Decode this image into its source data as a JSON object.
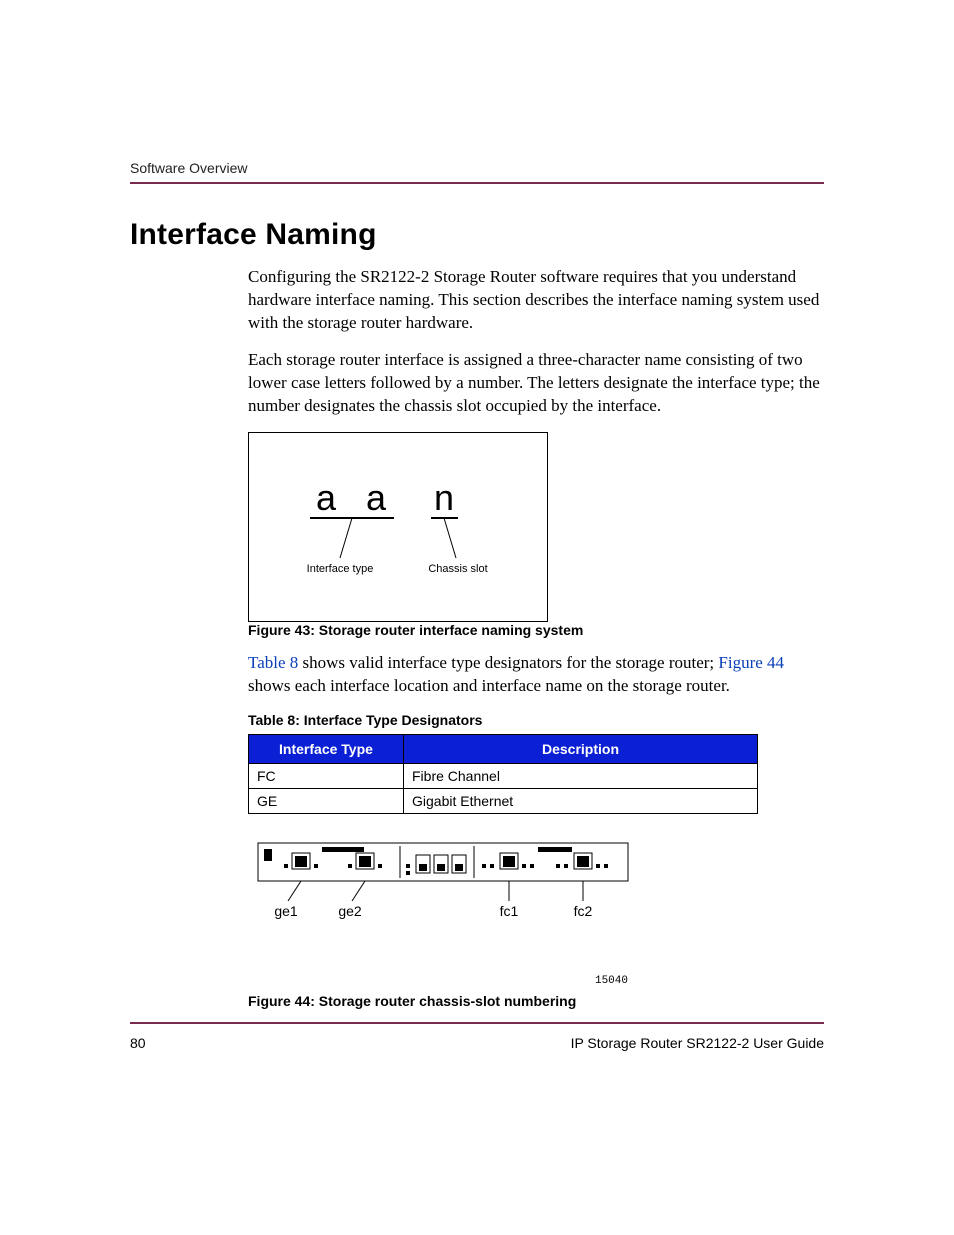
{
  "header": {
    "running": "Software Overview"
  },
  "title": "Interface Naming",
  "para1": "Configuring the SR2122-2 Storage Router software requires that you understand hardware interface naming. This section describes the interface naming system used with the storage router hardware.",
  "para2": "Each storage router interface is assigned a three-character name consisting of two lower case letters followed by a number. The letters designate the interface type; the number designates the chassis slot occupied by the interface.",
  "fig43": {
    "letters": {
      "a1": "a",
      "a2": "a",
      "n": "n"
    },
    "label_type": "Interface type",
    "label_slot": "Chassis slot",
    "caption": "Figure 43:  Storage router interface naming system"
  },
  "para3_pre": " shows valid interface type designators for the storage router; ",
  "para3_post": " shows each interface location and interface name on the storage router.",
  "link_table8": "Table 8",
  "link_fig44": "Figure 44",
  "table8": {
    "caption": "Table 8:  Interface Type Designators",
    "h1": "Interface Type",
    "h2": "Description",
    "r1c1": "FC",
    "r1c2": "Fibre Channel",
    "r2c1": "GE",
    "r2c2": "Gigabit Ethernet"
  },
  "fig44": {
    "ge1": "ge1",
    "ge2": "ge2",
    "fc1": "fc1",
    "fc2": "fc2",
    "id": "15040",
    "caption": "Figure 44:  Storage router chassis-slot numbering"
  },
  "footer": {
    "page": "80",
    "guide": "IP Storage Router SR2122-2 User Guide"
  }
}
